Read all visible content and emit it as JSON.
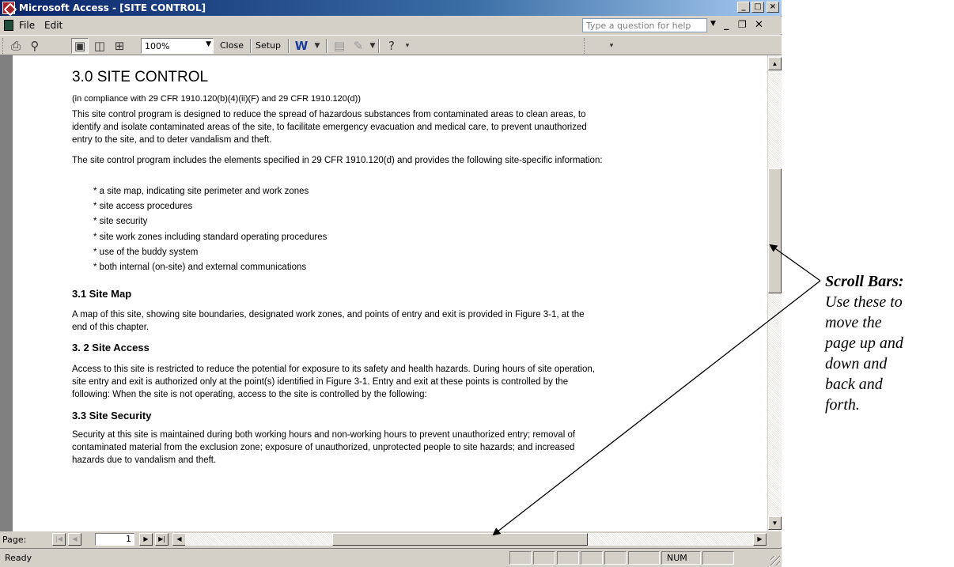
{
  "window": {
    "title": "Microsoft Access - [SITE CONTROL]",
    "caption_buttons": [
      "_",
      "□",
      "×"
    ]
  },
  "menubar": {
    "items": [
      "File",
      "Edit"
    ],
    "help_placeholder": "Type a question for help"
  },
  "toolbar": {
    "zoom": "100%",
    "close_label": "Close",
    "setup_label": "Setup"
  },
  "document": {
    "heading": "3.0  SITE CONTROL",
    "compliance": "(in compliance with 29 CFR 1910.120(b)(4)(ii)(F) and 29 CFR 1910.120(d))",
    "intro_lines": [
      "This site control program is designed to reduce the spread of hazardous substances from contaminated areas to clean areas, to",
      "identify and isolate contaminated areas of the site, to facilitate emergency evacuation and medical care, to prevent unauthorized",
      "entry to the site, and to deter vandalism and theft."
    ],
    "elements_intro": "The site control program includes the elements specified in 29 CFR 1910.120(d) and provides the following site-specific information:",
    "bullets": [
      "* a site map, indicating site perimeter and work zones",
      "* site access procedures",
      "* site security",
      "* site work zones including standard operating procedures",
      "* use of the buddy system",
      "* both internal (on-site) and external communications"
    ],
    "site_map": {
      "heading": "3.1 Site Map",
      "lines": [
        "A map of this site, showing site boundaries, designated work zones, and points of entry and exit is provided in Figure 3-1, at the",
        "end of this chapter."
      ]
    },
    "site_access": {
      "heading": "3. 2 Site Access",
      "lines": [
        "Access to this site is restricted to reduce the potential for exposure to its safety and health hazards.  During hours of site operation,",
        "site entry and exit is authorized only at the point(s) identified in Figure 3-1.  Entry and exit at these points is controlled by the",
        "following:    When the site is not operating, access to the site is controlled by the following:"
      ]
    },
    "site_security": {
      "heading": "3.3  Site Security",
      "lines": [
        "Security at this site is maintained during both working hours and non-working hours to prevent unauthorized entry; removal of",
        "contaminated material from the exclusion zone; exposure of unauthorized, unprotected people to site hazards; and increased",
        "hazards due to vandalism and theft."
      ]
    }
  },
  "navigation": {
    "page_label": "Page:",
    "page_number": "1"
  },
  "status": {
    "text": "Ready",
    "num": "NUM"
  },
  "annotation": {
    "heading": "Scroll Bars:",
    "lines": [
      "Use these to",
      "move the",
      "page up and",
      "down and",
      "back and",
      "forth."
    ]
  }
}
